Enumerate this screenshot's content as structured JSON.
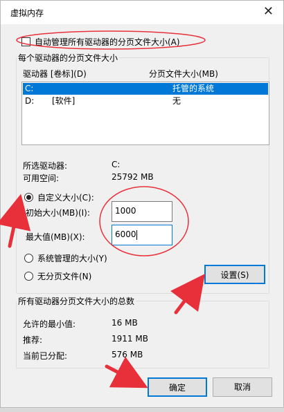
{
  "window": {
    "title": "虚拟内存",
    "close_glyph": "✕"
  },
  "auto_manage": {
    "label": "自动管理所有驱动器的分页文件大小(A)",
    "checked": false
  },
  "paging_group": {
    "legend": "每个驱动器的分页文件大小",
    "col_drive": "驱动器 [卷标](D)",
    "col_size": "分页文件大小(MB)",
    "drives": [
      {
        "drive": "C:",
        "label": "",
        "size": "托管的系统",
        "selected": true
      },
      {
        "drive": "D:",
        "label": "[软件]",
        "size": "无",
        "selected": false
      }
    ],
    "selected_drive_label": "所选驱动器:",
    "selected_drive_value": "C:",
    "free_space_label": "可用空间:",
    "free_space_value": "25792 MB",
    "custom_size_label": "自定义大小(C):",
    "initial_size_label": "初始大小(MB)(I):",
    "initial_size_value": "1000",
    "max_size_label": "最大值(MB)(X):",
    "max_size_value": "6000",
    "system_managed_label": "系统管理的大小(Y)",
    "no_paging_label": "无分页文件(N)",
    "set_button": "设置(S)"
  },
  "total_group": {
    "legend": "所有驱动器分页文件大小的总数",
    "min_label": "允许的最小值:",
    "min_value": "16 MB",
    "recommended_label": "推荐:",
    "recommended_value": "1911 MB",
    "allocated_label": "当前已分配:",
    "allocated_value": "576 MB"
  },
  "buttons": {
    "ok": "确定",
    "cancel": "取消"
  },
  "colors": {
    "selection": "#0078d7",
    "annotation": "#e8303a"
  }
}
